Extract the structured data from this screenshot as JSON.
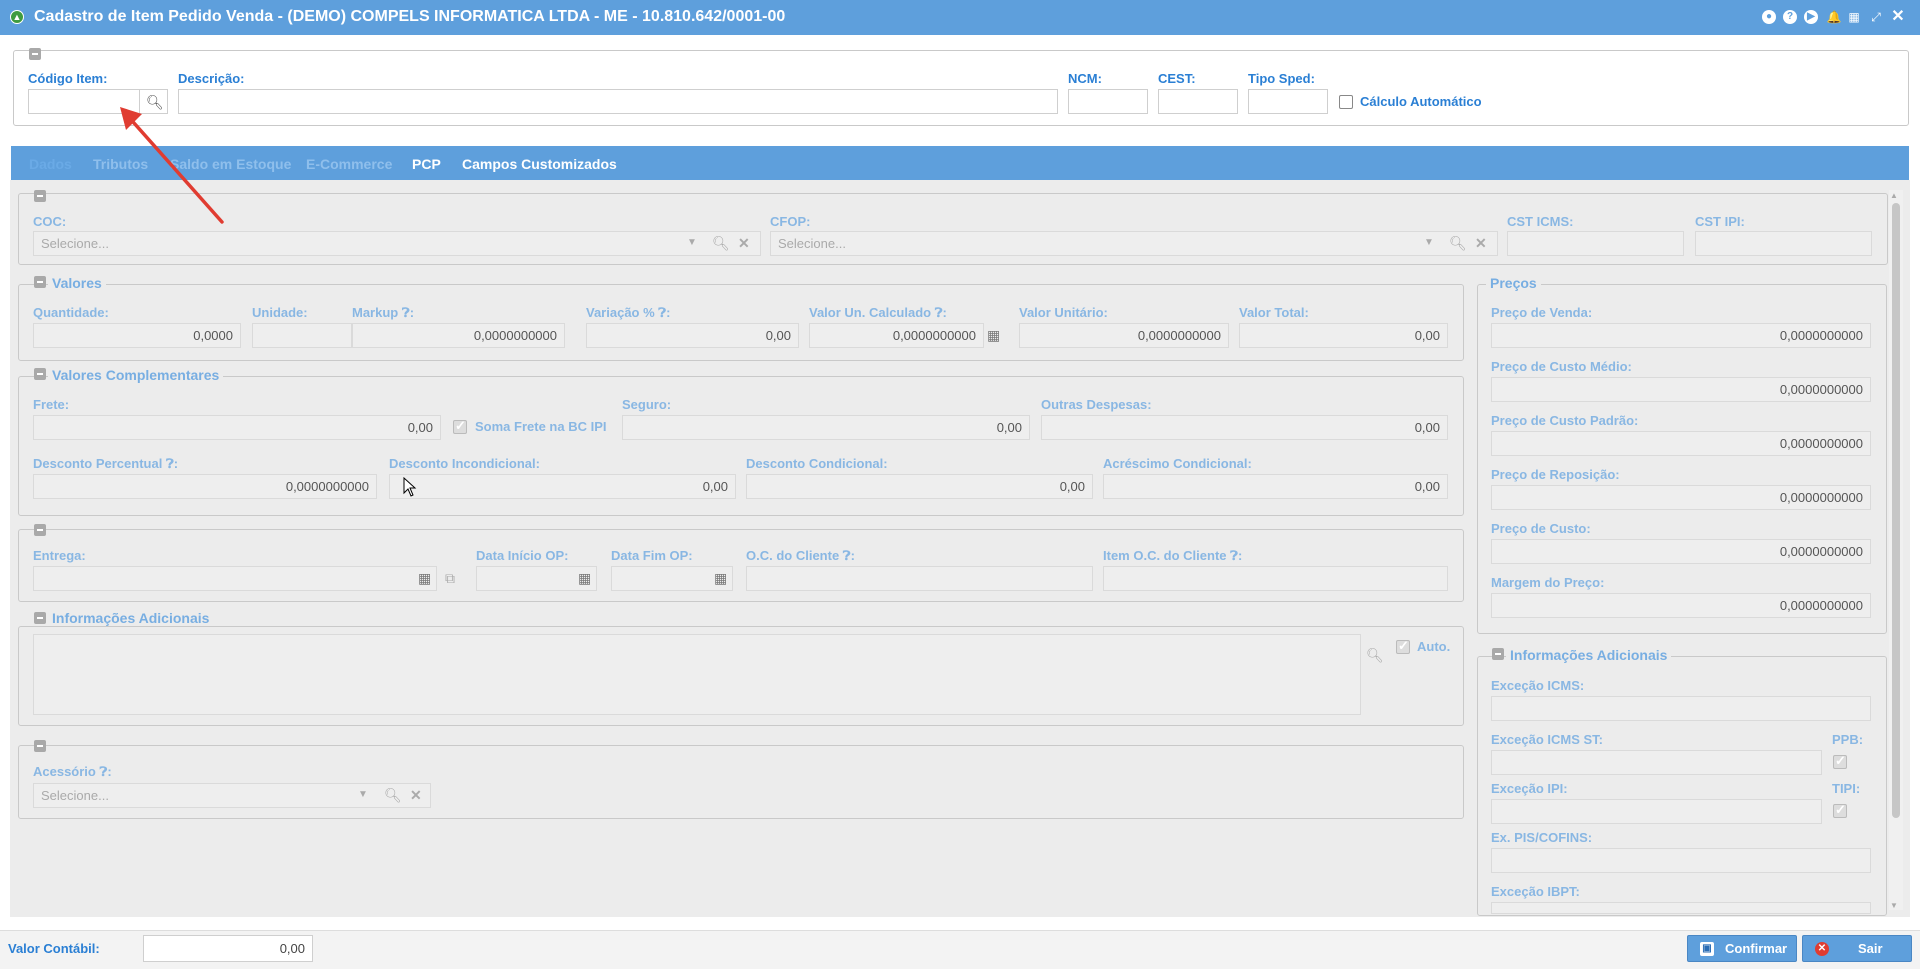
{
  "title": "Cadastro de Item Pedido Venda - (DEMO) COMPELS INFORMATICA LTDA - ME - 10.810.642/0001-00",
  "header": {
    "codigo_item_label": "Código Item:",
    "descricao_label": "Descrição:",
    "ncm_label": "NCM:",
    "cest_label": "CEST:",
    "tipo_sped_label": "Tipo Sped:",
    "calculo_automatico_label": "Cálculo Automático"
  },
  "tabs": [
    "Dados",
    "Tributos",
    "Saldo em Estoque",
    "E-Commerce",
    "PCP",
    "Campos Customizados"
  ],
  "coc": {
    "label": "COC:",
    "placeholder": "Selecione..."
  },
  "cfop": {
    "label": "CFOP:",
    "placeholder": "Selecione..."
  },
  "cst_icms_label": "CST ICMS:",
  "cst_ipi_label": "CST IPI:",
  "valores": {
    "legend": "Valores",
    "quantidade_label": "Quantidade:",
    "quantidade": "0,0000",
    "unidade_label": "Unidade:",
    "markup_label": "Markup",
    "markup": "0,0000000000",
    "variacao_label": "Variação %",
    "variacao": "0,00",
    "valor_un_calc_label": "Valor Un. Calculado",
    "valor_un_calc": "0,0000000000",
    "valor_unitario_label": "Valor Unitário:",
    "valor_unitario": "0,0000000000",
    "valor_total_label": "Valor Total:",
    "valor_total": "0,00"
  },
  "complementares": {
    "legend": "Valores Complementares",
    "frete_label": "Frete:",
    "frete": "0,00",
    "soma_frete_label": "Soma Frete na BC IPI",
    "seguro_label": "Seguro:",
    "seguro": "0,00",
    "outras_label": "Outras Despesas:",
    "outras": "0,00",
    "desc_perc_label": "Desconto Percentual",
    "desc_perc": "0,0000000000",
    "desc_incond_label": "Desconto Incondicional:",
    "desc_incond": "0,00",
    "desc_cond_label": "Desconto Condicional:",
    "desc_cond": "0,00",
    "acresc_label": "Acréscimo Condicional:",
    "acresc": "0,00"
  },
  "entrega": {
    "entrega_label": "Entrega:",
    "data_inicio_label": "Data Início OP:",
    "data_fim_label": "Data Fim OP:",
    "oc_cliente_label": "O.C. do Cliente",
    "item_oc_label": "Item O.C. do Cliente"
  },
  "info_adicionais": {
    "legend": "Informações Adicionais",
    "auto_label": "Auto."
  },
  "acessorio": {
    "label": "Acessório",
    "placeholder": "Selecione..."
  },
  "precos": {
    "legend": "Preços",
    "items": [
      {
        "label": "Preço de Venda:",
        "value": "0,0000000000"
      },
      {
        "label": "Preço de Custo Médio:",
        "value": "0,0000000000"
      },
      {
        "label": "Preço de Custo Padrão:",
        "value": "0,0000000000"
      },
      {
        "label": "Preço de Reposição:",
        "value": "0,0000000000"
      },
      {
        "label": "Preço de Custo:",
        "value": "0,0000000000"
      },
      {
        "label": "Margem do Preço:",
        "value": "0,0000000000"
      }
    ]
  },
  "info_right": {
    "legend": "Informações Adicionais",
    "excecao_icms_label": "Exceção ICMS:",
    "excecao_icms_st_label": "Exceção ICMS ST:",
    "ppb_label": "PPB:",
    "excecao_ipi_label": "Exceção IPI:",
    "tipi_label": "TIPI:",
    "ex_pis_label": "Ex. PIS/COFINS:",
    "excecao_ibpt_label": "Exceção IBPT:"
  },
  "footer": {
    "valor_contabil_label": "Valor Contábil:",
    "valor_contabil": "0,00",
    "confirmar_label": "Confirmar",
    "sair_label": "Sair"
  },
  "colors": {
    "accent": "#5e9fdc",
    "label": "#2a7fd4",
    "annotation_arrow": "#e03c31"
  }
}
